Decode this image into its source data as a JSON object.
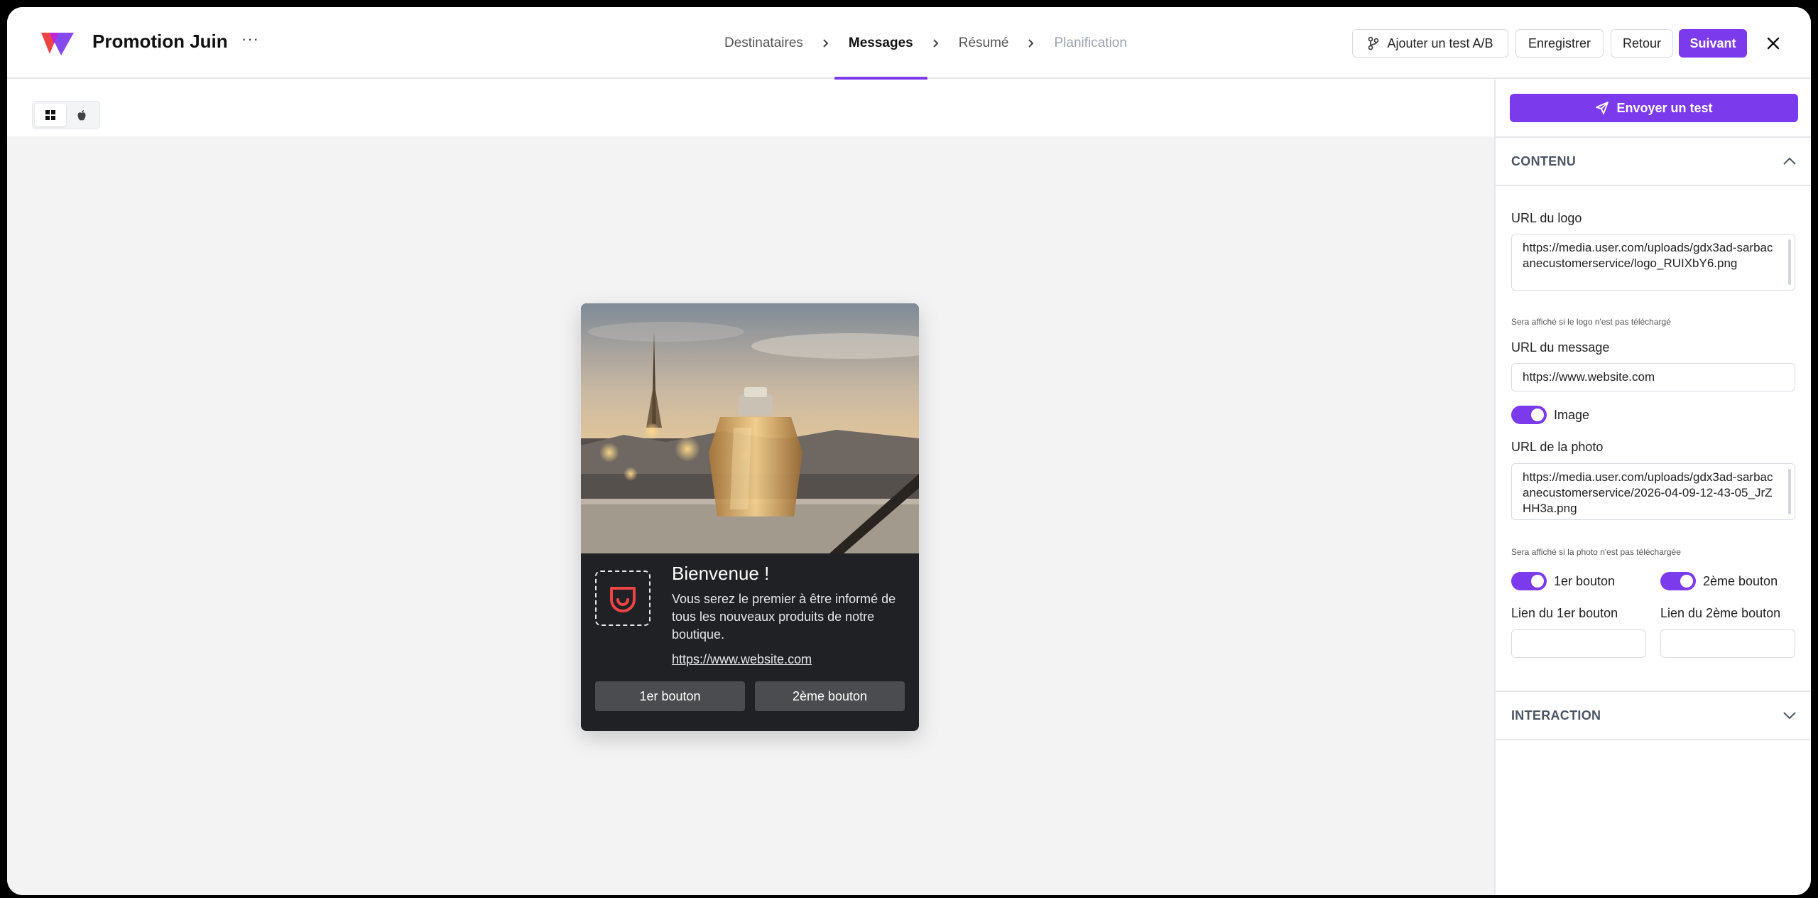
{
  "header": {
    "title": "Promotion Juin",
    "more": "···",
    "steps": [
      {
        "label": "Destinataires"
      },
      {
        "label": "Messages"
      },
      {
        "label": "Résumé"
      },
      {
        "label": "Planification"
      }
    ],
    "ab_test_label": "Ajouter un test A/B",
    "save_label": "Enregistrer",
    "back_label": "Retour",
    "next_label": "Suivant"
  },
  "preview": {
    "title": "Bienvenue !",
    "body": "Vous serez le premier à être informé de tous les nouveaux produits de notre boutique.",
    "link": "https://www.website.com",
    "button1": "1er bouton",
    "button2": "2ème bouton"
  },
  "panel": {
    "send_test_label": "Envoyer un test",
    "content_section": "CONTENU",
    "logo_url_label": "URL du logo",
    "logo_url_value": "https://media.user.com/uploads/gdx3ad-sarbacanecustomerservice/logo_RUIXbY6.png",
    "logo_hint": "Sera affiché si le logo n'est pas téléchargé",
    "message_url_label": "URL du message",
    "message_url_value": "https://www.website.com",
    "image_toggle_label": "Image",
    "photo_url_label": "URL de la photo",
    "photo_url_value": "https://media.user.com/uploads/gdx3ad-sarbacanecustomerservice/2026-04-09-12-43-05_JrZHH3a.png",
    "photo_hint": "Sera affiché si la photo n'est pas téléchargée",
    "button1_toggle_label": "1er bouton",
    "button2_toggle_label": "2ème bouton",
    "button1_link_label": "Lien du 1er bouton",
    "button2_link_label": "Lien du 2ème bouton",
    "button1_link_value": "",
    "button2_link_value": "",
    "interaction_section": "INTERACTION"
  },
  "colors": {
    "accent": "#7c3aed",
    "notification_bg": "#202124",
    "canvas_bg": "#f3f3f4"
  }
}
